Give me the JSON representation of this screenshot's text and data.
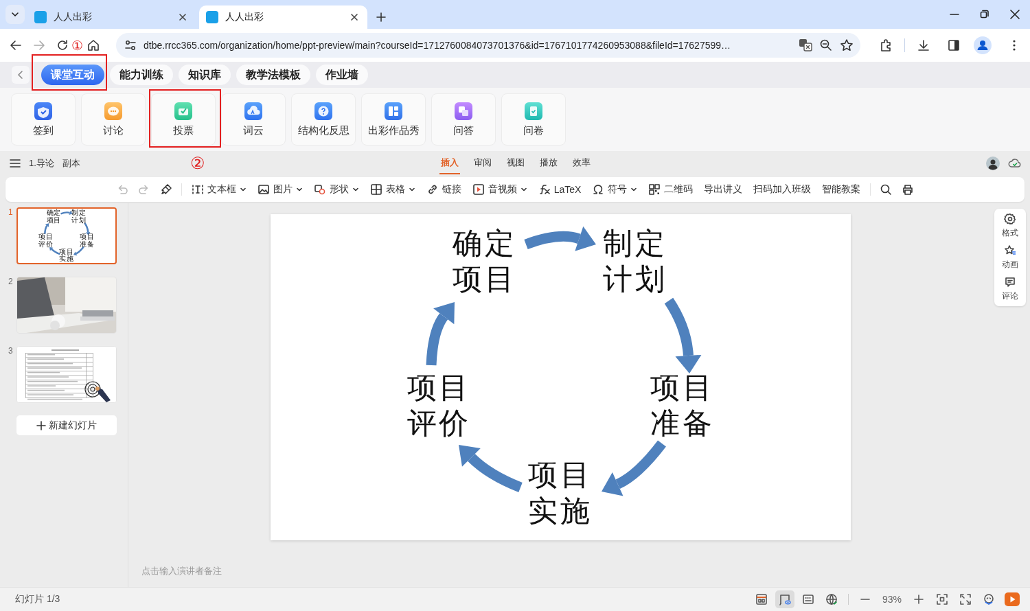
{
  "browser": {
    "tabs": [
      {
        "title": "人人出彩",
        "selected": false
      },
      {
        "title": "人人出彩",
        "selected": true
      }
    ],
    "forward_disabled": true,
    "annotation": "①",
    "url": "dtbe.rrcc365.com/organization/home/ppt-preview/main?courseId=1712760084073701376&id=1767101774260953088&fileId=17627599…"
  },
  "module_tabs": [
    {
      "label": "课堂互动",
      "selected": true,
      "annotated": true
    },
    {
      "label": "能力训练",
      "selected": false,
      "annotated": false
    },
    {
      "label": "知识库",
      "selected": false,
      "annotated": false
    },
    {
      "label": "教学法模板",
      "selected": false,
      "annotated": false
    },
    {
      "label": "作业墙",
      "selected": false,
      "annotated": false
    }
  ],
  "tools": [
    {
      "label": "签到",
      "annotated": false
    },
    {
      "label": "讨论",
      "annotated": false
    },
    {
      "label": "投票",
      "annotated": true
    },
    {
      "label": "词云",
      "annotated": false
    },
    {
      "label": "结构化反思",
      "annotated": false
    },
    {
      "label": "出彩作品秀",
      "annotated": false
    },
    {
      "label": "问答",
      "annotated": false
    },
    {
      "label": "问卷",
      "annotated": false
    }
  ],
  "editor": {
    "doc_title": "1.导论",
    "doc_tag": "副本",
    "annotation": "②",
    "menu": [
      {
        "label": "插入",
        "selected": true
      },
      {
        "label": "审阅",
        "selected": false
      },
      {
        "label": "视图",
        "selected": false
      },
      {
        "label": "播放",
        "selected": false
      },
      {
        "label": "效率",
        "selected": false
      }
    ]
  },
  "toolbar": {
    "undo_disabled": true,
    "redo_disabled": true,
    "items": [
      {
        "label": "文本框",
        "dropdown": true
      },
      {
        "label": "图片",
        "dropdown": true
      },
      {
        "label": "形状",
        "dropdown": true
      },
      {
        "label": "表格",
        "dropdown": true
      },
      {
        "label": "链接",
        "dropdown": false
      },
      {
        "label": "音视频",
        "dropdown": true
      },
      {
        "label": "LaTeX",
        "dropdown": false
      },
      {
        "label": "符号",
        "dropdown": true
      },
      {
        "label": "二维码",
        "dropdown": false
      },
      {
        "label": "导出讲义",
        "dropdown": false
      },
      {
        "label": "扫码加入班级",
        "dropdown": false
      },
      {
        "label": "智能教案",
        "dropdown": false
      }
    ]
  },
  "slides": [
    {
      "number": "1",
      "selected": true,
      "kind": "diagram",
      "labels": [
        "确定项目",
        "制定计划",
        "项目准备",
        "项目实施",
        "项目评价"
      ]
    },
    {
      "number": "2",
      "selected": false,
      "kind": "picture"
    },
    {
      "number": "3",
      "selected": false,
      "kind": "document"
    }
  ],
  "new_slide": "新建幻灯片",
  "slide": {
    "labels": [
      "确定项目",
      "制定计划",
      "项目准备",
      "项目实施",
      "项目评价"
    ]
  },
  "side_panel": [
    {
      "label": "格式"
    },
    {
      "label": "动画"
    },
    {
      "label": "评论"
    }
  ],
  "notes": {
    "placeholder": "点击输入演讲者备注"
  },
  "status_bar": {
    "slide_counter": "幻灯片 1/3",
    "views": [
      {
        "selected": false
      },
      {
        "selected": true
      },
      {
        "selected": false
      },
      {
        "selected": false
      }
    ],
    "zoom": "93%"
  }
}
